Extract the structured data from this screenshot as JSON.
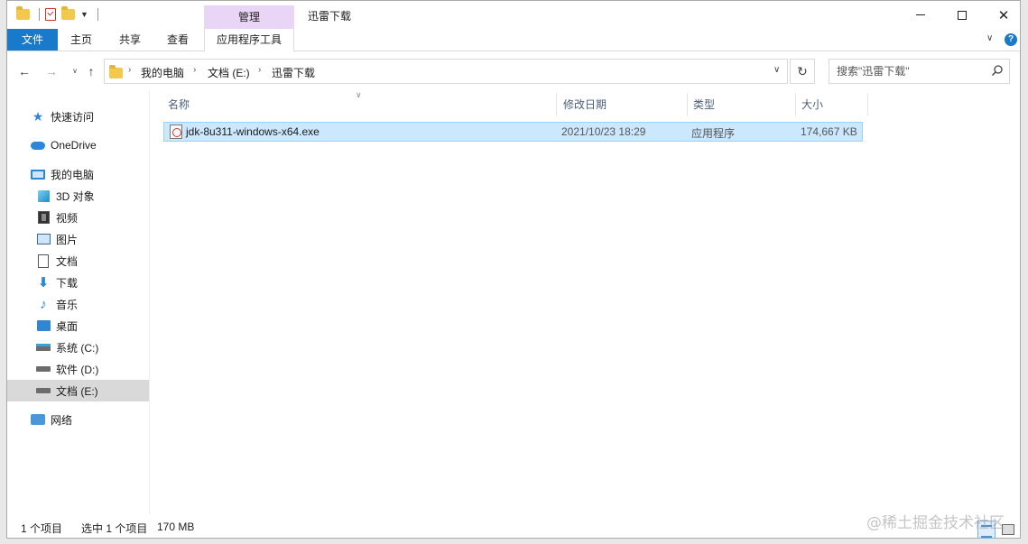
{
  "window": {
    "title": "迅雷下载",
    "manage_label": "管理"
  },
  "ribbon": {
    "tabs": [
      "文件",
      "主页",
      "共享",
      "查看",
      "应用程序工具"
    ]
  },
  "address": {
    "crumbs": [
      "我的电脑",
      "文档 (E:)",
      "迅雷下载"
    ]
  },
  "search": {
    "placeholder": "搜索\"迅雷下载\""
  },
  "nav": {
    "items": [
      {
        "label": "快速访问",
        "icon": "star-icon"
      },
      {
        "label": "OneDrive",
        "icon": "cloud-icon"
      },
      {
        "label": "我的电脑",
        "icon": "computer-icon"
      },
      {
        "label": "3D 对象",
        "icon": "cube-icon"
      },
      {
        "label": "视频",
        "icon": "video-icon"
      },
      {
        "label": "图片",
        "icon": "picture-icon"
      },
      {
        "label": "文档",
        "icon": "document-icon"
      },
      {
        "label": "下载",
        "icon": "download-icon"
      },
      {
        "label": "音乐",
        "icon": "music-icon"
      },
      {
        "label": "桌面",
        "icon": "desktop-icon"
      },
      {
        "label": "系统 (C:)",
        "icon": "system-drive-icon"
      },
      {
        "label": "软件 (D:)",
        "icon": "drive-icon"
      },
      {
        "label": "文档 (E:)",
        "icon": "drive-icon"
      },
      {
        "label": "网络",
        "icon": "network-icon"
      }
    ],
    "selected": "文档 (E:)"
  },
  "columns": [
    "名称",
    "修改日期",
    "类型",
    "大小"
  ],
  "files": [
    {
      "name": "jdk-8u311-windows-x64.exe",
      "modified": "2021/10/23 18:29",
      "type": "应用程序",
      "size": "174,667 KB"
    }
  ],
  "status": {
    "count": "1 个项目",
    "selected": "选中 1 个项目",
    "size": "170 MB"
  },
  "watermark": "@稀土掘金技术社区",
  "colors": {
    "accent": "#1979ca",
    "manage_tab": "#e9d5f5",
    "selection": "#cce8ff"
  }
}
